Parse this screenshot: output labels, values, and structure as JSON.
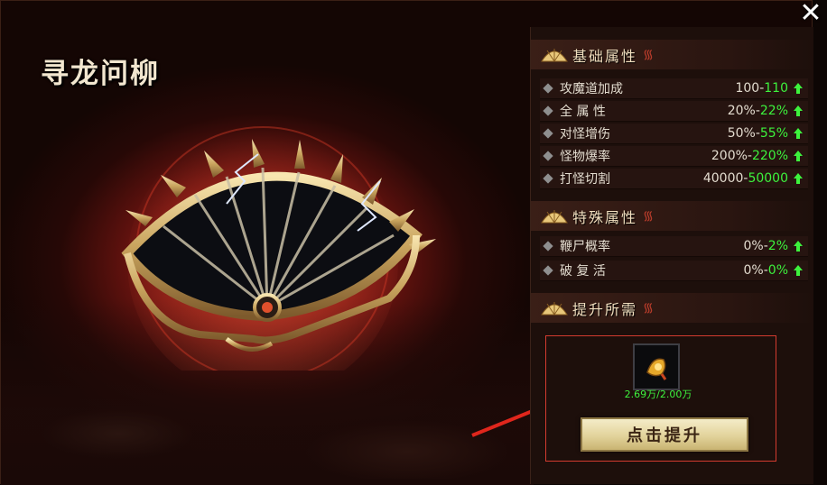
{
  "window": {
    "title": "寻龙问柳",
    "close_icon": "close-icon"
  },
  "colors": {
    "accent_red": "#c0281c",
    "new_value_green": "#3df23d",
    "button_gold": "#e2d39b",
    "highlight_box": "#d33b2f"
  },
  "sections": {
    "base": {
      "title": "基础属性",
      "rows": [
        {
          "name": "攻魔道加成",
          "current": "100-",
          "next": "110"
        },
        {
          "name": "全 属 性",
          "current": "20%-",
          "next": "22%"
        },
        {
          "name": "对怪增伤",
          "current": "50%-",
          "next": "55%"
        },
        {
          "name": "怪物爆率",
          "current": "200%-",
          "next": "220%"
        },
        {
          "name": "打怪切割",
          "current": "40000-",
          "next": "50000"
        }
      ]
    },
    "special": {
      "title": "特殊属性",
      "rows": [
        {
          "name": "鞭尸概率",
          "current": "0%-",
          "next": "2%"
        },
        {
          "name": "破 复 活",
          "current": "0%-",
          "next": "0%"
        }
      ]
    },
    "requirements": {
      "title": "提升所需",
      "item_icon": "golden-token-item-icon",
      "item_count": "2.69万/2.00万",
      "upgrade_button": "点击提升"
    }
  }
}
